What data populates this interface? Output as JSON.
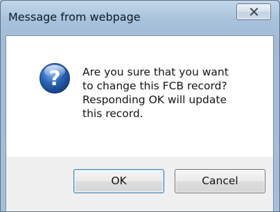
{
  "dialog": {
    "title": "Message from webpage",
    "message": "Are you sure that you want\nto change this FCB record?\nResponding OK will update\nthis record.",
    "icon": "question-icon",
    "close_icon": "close-icon",
    "buttons": {
      "ok_label": "OK",
      "cancel_label": "Cancel"
    }
  },
  "colors": {
    "frame": "#a8c2dc",
    "content_background": "#ffffff",
    "footer_background": "#f0f0f0",
    "icon_blue": "#2a63b8"
  }
}
